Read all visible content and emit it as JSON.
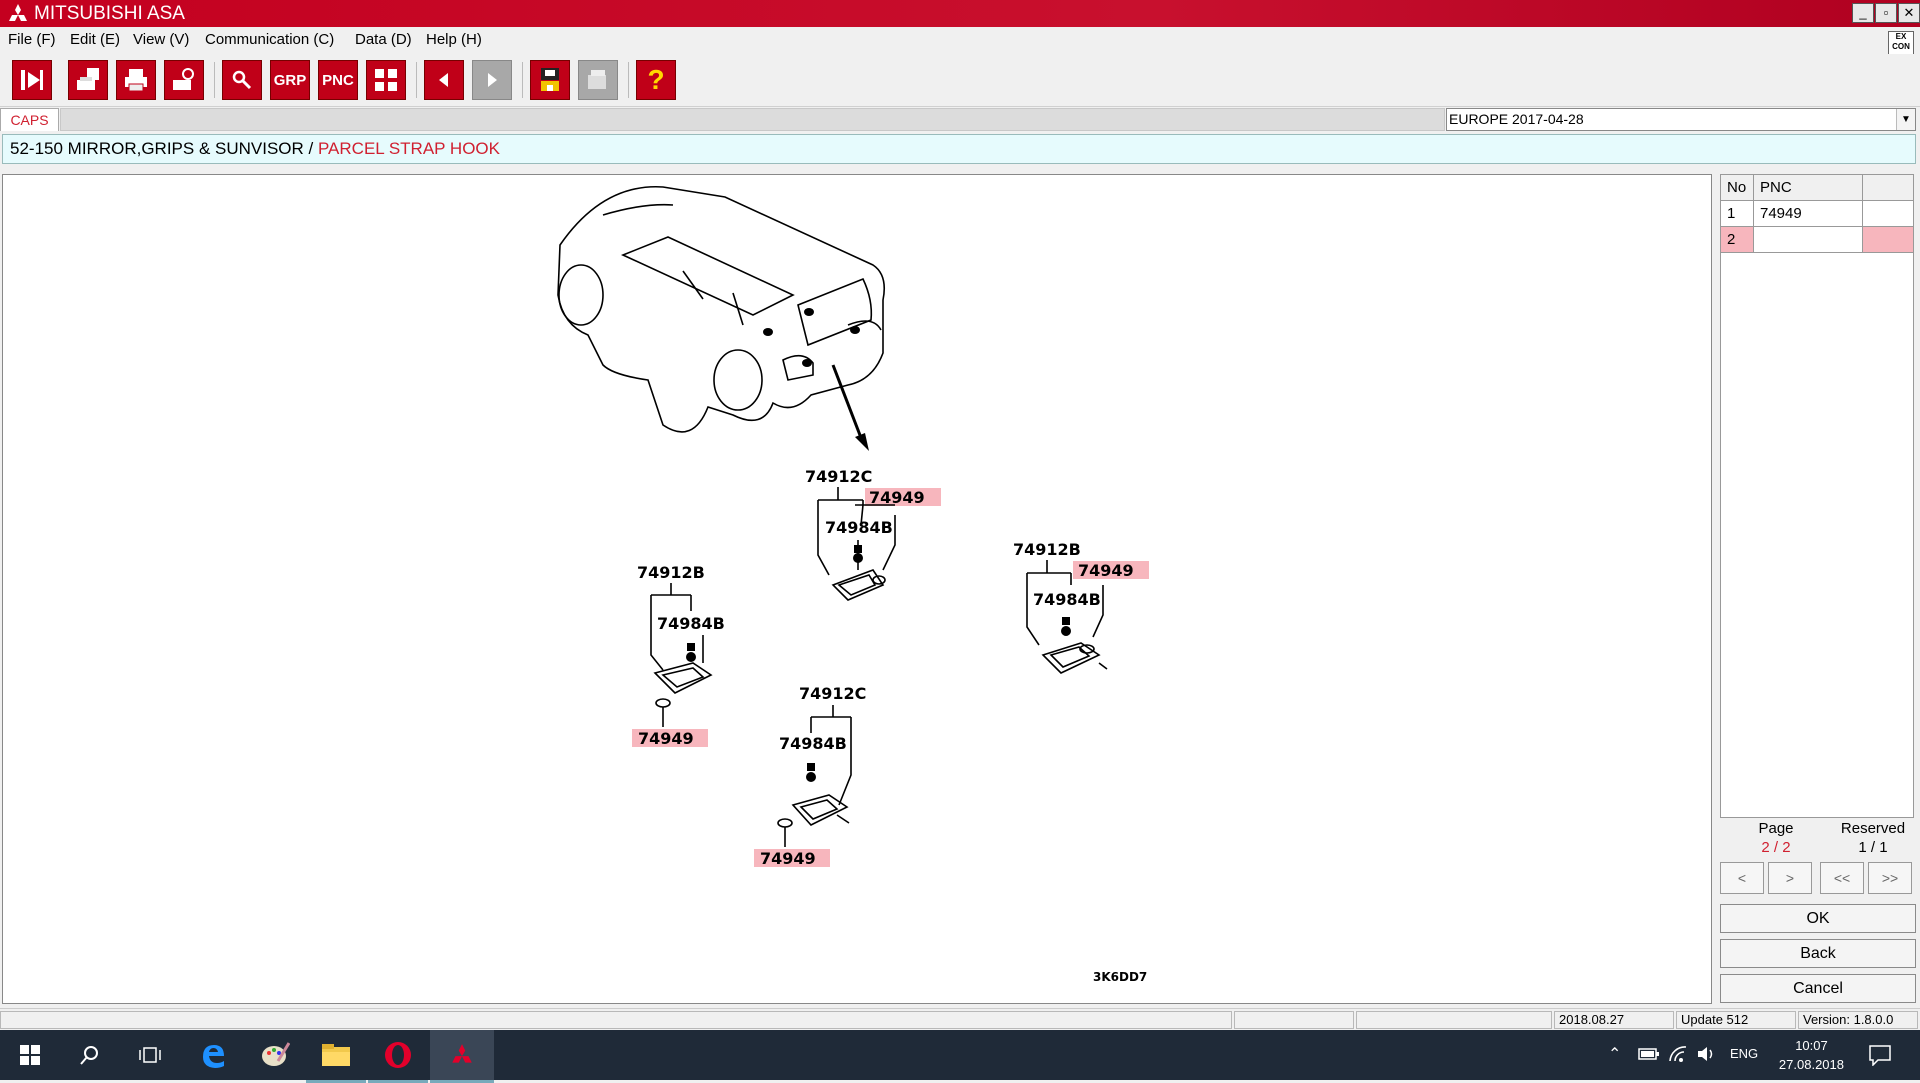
{
  "window": {
    "title": "MITSUBISHI ASA",
    "minimize": "_",
    "restore": "▫",
    "close": "✕"
  },
  "menu": [
    "File (F)",
    "Edit (E)",
    "View (V)",
    "Communication (C)",
    "Data (D)",
    "Help (H)"
  ],
  "excon_label": "EX CON",
  "toolbar": {
    "grp_label": "GRP",
    "pnc_label": "PNC",
    "help_label": "?"
  },
  "caps_tab": "CAPS",
  "region": "EUROPE   2017-04-28",
  "breadcrumb": {
    "group": "52-150  MIRROR,GRIPS & SUNVISOR / ",
    "current": "PARCEL STRAP HOOK"
  },
  "diagram": {
    "labels_a": [
      "74912C",
      "74984B"
    ],
    "labels_b": [
      "74912B",
      "74984B"
    ],
    "labels_c": [
      "74912B",
      "74984B"
    ],
    "labels_d": [
      "74912C",
      "74984B"
    ],
    "highlight_pnc": "74949",
    "illustration_code": "3K6DD7"
  },
  "pnc_table": {
    "headers": [
      "No",
      "PNC",
      ""
    ],
    "rows": [
      {
        "no": "1",
        "pnc": "74949"
      },
      {
        "no": "2",
        "pnc": ""
      }
    ]
  },
  "paging": {
    "page_label": "Page",
    "page_value": "2 / 2",
    "reserved_label": "Reserved",
    "reserved_value": "1 / 1",
    "prev": "<",
    "next": ">",
    "first": "<<",
    "last": ">>"
  },
  "buttons": {
    "ok": "OK",
    "back": "Back",
    "cancel": "Cancel"
  },
  "status": {
    "date": "2018.08.27",
    "update": "Update 512",
    "version": "Version: 1.8.0.0"
  },
  "taskbar": {
    "lang": "ENG",
    "time": "10:07",
    "date": "27.08.2018"
  },
  "colors": {
    "brand_red": "#c8102e",
    "highlight_pink": "#f7b6bd",
    "breadcrumb_bg": "#e6fbfd"
  }
}
